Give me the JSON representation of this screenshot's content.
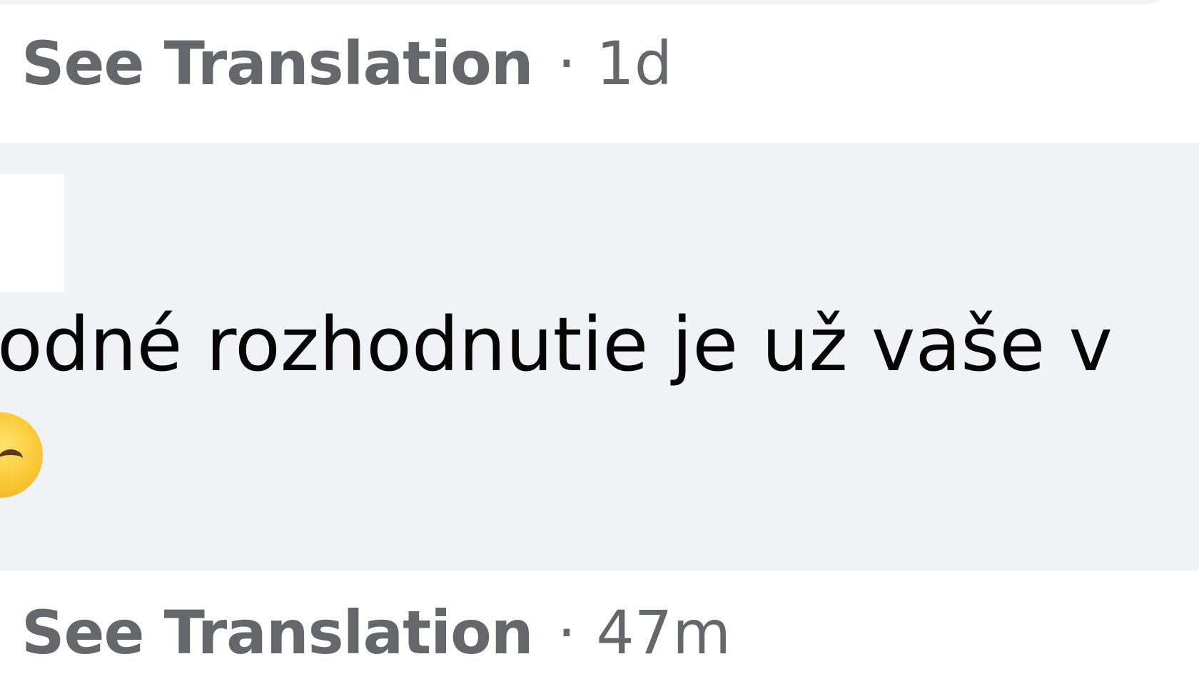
{
  "comments": [
    {
      "actions": {
        "see_translation_label": "See Translation",
        "separator": "·",
        "timestamp": "1d"
      }
    },
    {
      "text": "odné rozhodnutie je už vaše v",
      "emoji_icon": "smiling-face-icon",
      "actions": {
        "see_translation_label": "See Translation",
        "separator": "·",
        "timestamp": "47m"
      }
    }
  ],
  "colors": {
    "bubble_background": "#f0f2f5",
    "secondary_text": "#65676b",
    "primary_text": "#050505"
  }
}
